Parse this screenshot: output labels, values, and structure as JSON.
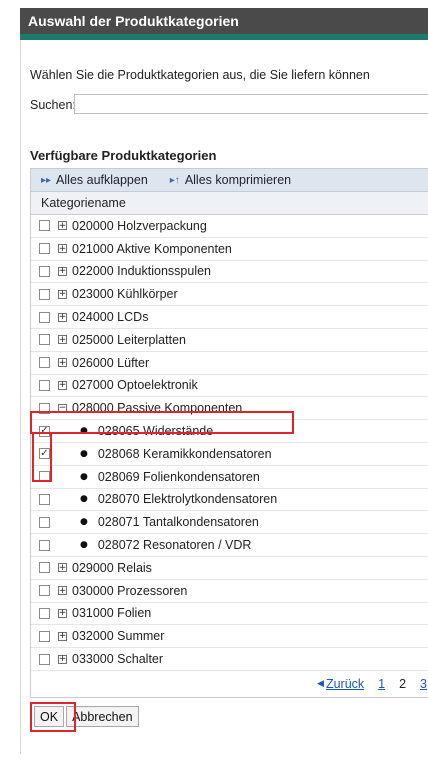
{
  "dialog": {
    "title": "Auswahl der Produktkategorien",
    "intro": "Wählen Sie die Produktkategorien aus, die Sie liefern können",
    "search_label": "Suchen:",
    "search_value": ""
  },
  "section": {
    "title": "Verfügbare Produktkategorien"
  },
  "toolbar": {
    "expand_label": "Alles aufklappen",
    "collapse_label": "Alles komprimieren"
  },
  "table": {
    "column_header": "Kategoriename",
    "rows_before": [
      {
        "label": "020000 Holzverpackung",
        "checked": false,
        "expander": "+"
      },
      {
        "label": "021000 Aktive Komponenten",
        "checked": false,
        "expander": "+"
      },
      {
        "label": "022000 Induktionsspulen",
        "checked": false,
        "expander": "+"
      },
      {
        "label": "023000 Kühlkörper",
        "checked": false,
        "expander": "+"
      },
      {
        "label": "024000 LCDs",
        "checked": false,
        "expander": "+"
      },
      {
        "label": "025000 Leiterplatten",
        "checked": false,
        "expander": "+"
      },
      {
        "label": "026000 Lüfter",
        "checked": false,
        "expander": "+"
      },
      {
        "label": "027000 Optoelektronik",
        "checked": false,
        "expander": "+"
      }
    ],
    "expanded": {
      "label": "028000 Passive Komponenten",
      "checked": false,
      "expander": "−"
    },
    "children": [
      {
        "label": "028065 Widerstände",
        "checked": true
      },
      {
        "label": "028068 Keramikkondensatoren",
        "checked": true
      },
      {
        "label": "028069 Folienkondensatoren",
        "checked": false
      },
      {
        "label": "028070 Elektrolytkondensatoren",
        "checked": false
      },
      {
        "label": "028071 Tantalkondensatoren",
        "checked": false
      },
      {
        "label": "028072 Resonatoren / VDR",
        "checked": false
      }
    ],
    "rows_after": [
      {
        "label": "029000 Relais",
        "checked": false,
        "expander": "+"
      },
      {
        "label": "030000 Prozessoren",
        "checked": false,
        "expander": "+"
      },
      {
        "label": "031000 Folien",
        "checked": false,
        "expander": "+"
      },
      {
        "label": "032000 Summer",
        "checked": false,
        "expander": "+"
      },
      {
        "label": "033000 Schalter",
        "checked": false,
        "expander": "+"
      }
    ]
  },
  "pager": {
    "prev_label": "Zurück",
    "pages": [
      "1",
      "2",
      "3"
    ],
    "current_page": "2"
  },
  "buttons": {
    "ok_label": "OK",
    "cancel_label": "Abbrechen"
  },
  "colors": {
    "title_bar": "#4a4a4a",
    "accent_bar": "#1f7a6e",
    "highlight": "#e0242c",
    "link": "#1a56c4"
  },
  "icons": {
    "expand_all": "expand-all-icon",
    "collapse_all": "collapse-all-icon",
    "tree_expand": "plus-box-icon",
    "tree_collapse": "minus-box-icon",
    "prev": "triangle-left-icon"
  }
}
